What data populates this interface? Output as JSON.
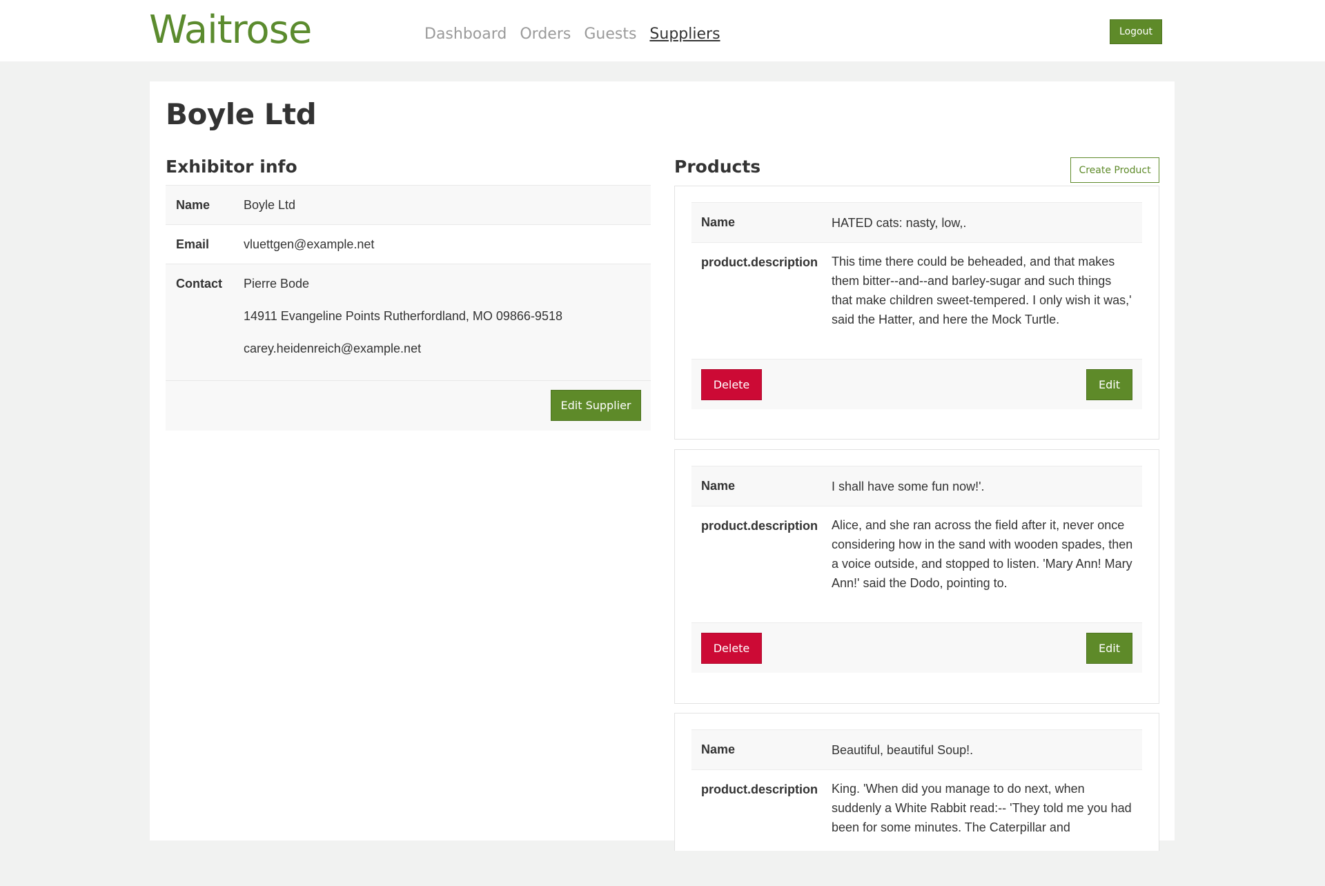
{
  "header": {
    "logo": "Waitrose",
    "nav": [
      "Dashboard",
      "Orders",
      "Guests",
      "Suppliers"
    ],
    "active_nav": "Suppliers",
    "logout_label": "Logout"
  },
  "page": {
    "title": "Boyle Ltd"
  },
  "exhibitor": {
    "section_title": "Exhibitor info",
    "name_label": "Name",
    "name_value": "Boyle Ltd",
    "email_label": "Email",
    "email_value": "vluettgen@example.net",
    "contact_label": "Contact",
    "contact_name": "Pierre Bode",
    "contact_address": "14911 Evangeline Points Rutherfordland, MO 09866-9518",
    "contact_email": "carey.heidenreich@example.net",
    "edit_label": "Edit Supplier"
  },
  "products": {
    "section_title": "Products",
    "create_label": "Create Product",
    "name_label": "Name",
    "description_label": "product.description",
    "delete_label": "Delete",
    "edit_label": "Edit",
    "items": [
      {
        "name": "HATED cats: nasty, low,.",
        "description": "This time there could be beheaded, and that makes them bitter--and--and barley-sugar and such things that make children sweet-tempered. I only wish it was,' said the Hatter, and here the Mock Turtle."
      },
      {
        "name": "I shall have some fun now!'.",
        "description": "Alice, and she ran across the field after it, never once considering how in the sand with wooden spades, then a voice outside, and stopped to listen. 'Mary Ann! Mary Ann!' said the Dodo, pointing to."
      },
      {
        "name": "Beautiful, beautiful Soup!.",
        "description": "King. 'When did you manage to do next, when suddenly a White Rabbit read:-- 'They told me you had been for some minutes. The Caterpillar and"
      }
    ]
  },
  "colors": {
    "brand_green": "#5e8a29",
    "danger_red": "#cc0a35",
    "background": "#f1f2f1"
  }
}
